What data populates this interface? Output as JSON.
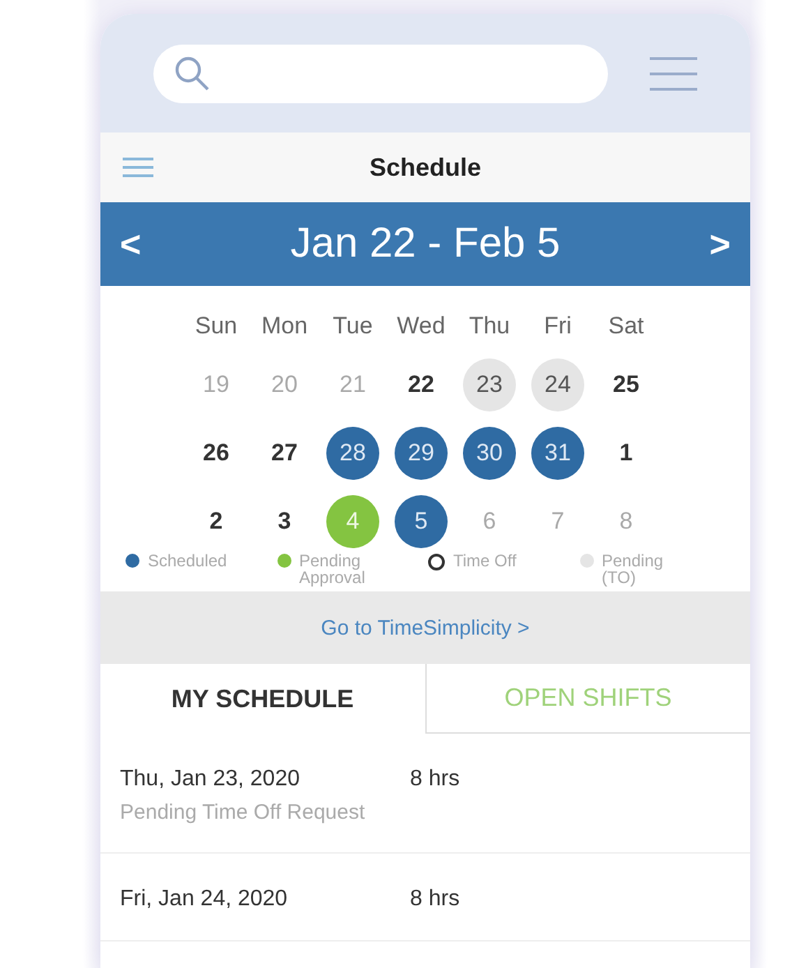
{
  "title": "Schedule",
  "range": {
    "label": "Jan 22 - Feb 5",
    "prev": "<",
    "next": ">"
  },
  "weekdays": [
    "Sun",
    "Mon",
    "Tue",
    "Wed",
    "Thu",
    "Fri",
    "Sat"
  ],
  "weeks": [
    [
      {
        "day": "19",
        "kind": "muted"
      },
      {
        "day": "20",
        "kind": "muted"
      },
      {
        "day": "21",
        "kind": "muted"
      },
      {
        "day": "22",
        "kind": "normal"
      },
      {
        "day": "23",
        "kind": "pending_to"
      },
      {
        "day": "24",
        "kind": "pending_to"
      },
      {
        "day": "25",
        "kind": "normal"
      }
    ],
    [
      {
        "day": "26",
        "kind": "normal"
      },
      {
        "day": "27",
        "kind": "normal"
      },
      {
        "day": "28",
        "kind": "scheduled"
      },
      {
        "day": "29",
        "kind": "scheduled"
      },
      {
        "day": "30",
        "kind": "scheduled"
      },
      {
        "day": "31",
        "kind": "scheduled"
      },
      {
        "day": "1",
        "kind": "normal"
      }
    ],
    [
      {
        "day": "2",
        "kind": "normal"
      },
      {
        "day": "3",
        "kind": "normal"
      },
      {
        "day": "4",
        "kind": "pending"
      },
      {
        "day": "5",
        "kind": "scheduled"
      },
      {
        "day": "6",
        "kind": "muted"
      },
      {
        "day": "7",
        "kind": "muted"
      },
      {
        "day": "8",
        "kind": "muted"
      }
    ]
  ],
  "legend": [
    {
      "label": "Scheduled",
      "kind": "scheduled"
    },
    {
      "label": "Pending Approval",
      "kind": "pending"
    },
    {
      "label": "Time Off",
      "kind": "time_off"
    },
    {
      "label": "Pending (TO)",
      "kind": "pending_to"
    }
  ],
  "link": "Go to TimeSimplicity >",
  "tabs": [
    {
      "label": "MY SCHEDULE",
      "selected": true
    },
    {
      "label": "OPEN SHIFTS",
      "selected": false
    }
  ],
  "shifts": [
    {
      "date": "Thu, Jan 23, 2020",
      "hours": "8 hrs",
      "note": "Pending Time Off Request"
    },
    {
      "date": "Fri, Jan 24, 2020",
      "hours": "8 hrs"
    }
  ]
}
